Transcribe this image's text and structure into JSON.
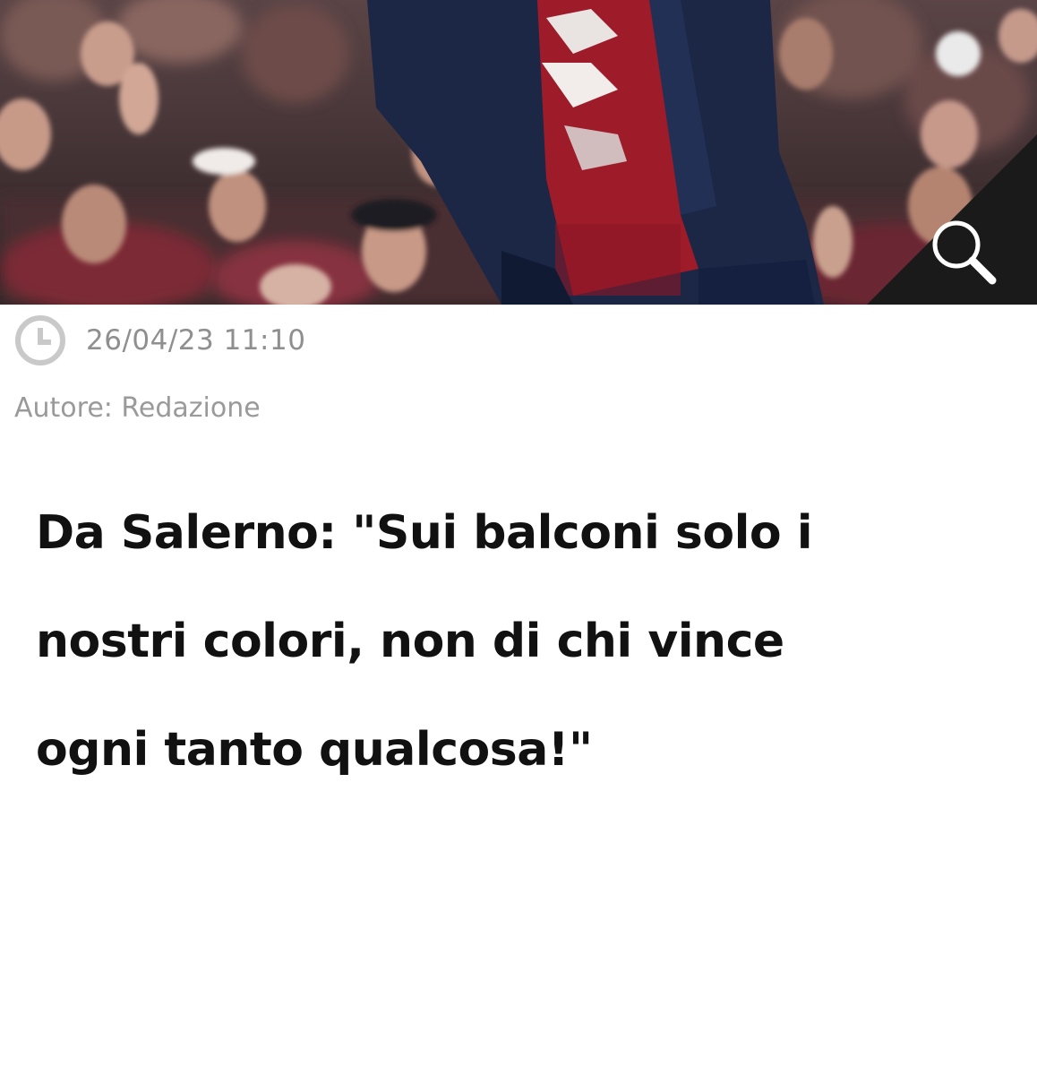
{
  "article": {
    "hero_image_alt": "Tifoso con sciarpa granata tra il pubblico allo stadio",
    "timestamp": "26/04/23 11:10",
    "author": "Autore: Redazione",
    "headline_lines": [
      "Da Salerno: \"Sui balconi solo i",
      "nostri colori, non di chi vince",
      "ogni tanto qualcosa!\""
    ]
  },
  "icons": {
    "clock": "clock-icon",
    "zoom": "search-icon"
  },
  "colors": {
    "meta_text": "#8f8f8f",
    "headline_text": "#111111",
    "scarf_red": "#9e1b2a",
    "jacket_navy": "#1c2746",
    "zoom_corner": "#1a1a1a"
  }
}
